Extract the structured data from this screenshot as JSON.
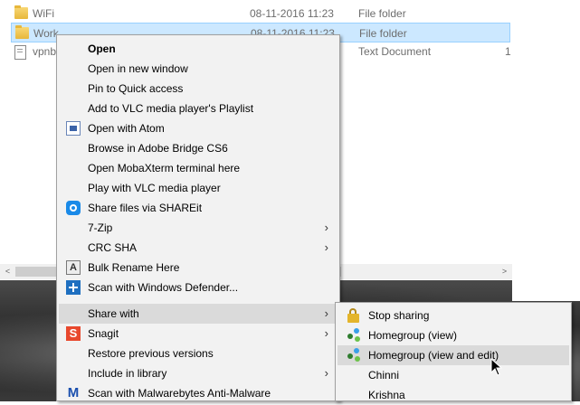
{
  "explorer": {
    "files": [
      {
        "name": "WiFi",
        "date": "08-11-2016 11:23",
        "type": "File folder",
        "size": "",
        "icon": "folder-icon",
        "selected": false
      },
      {
        "name": "Work",
        "date": "08-11-2016 11:23",
        "type": "File folder",
        "size": "",
        "icon": "folder-icon",
        "selected": true
      },
      {
        "name": "vpnb",
        "date": "",
        "type": "Text Document",
        "size": "1",
        "icon": "document-icon",
        "selected": false
      }
    ],
    "scroll_left": "<",
    "scroll_right": ">"
  },
  "context_menu": {
    "items": [
      {
        "label": "Open",
        "bold": true,
        "icon": "",
        "submenu": false
      },
      {
        "label": "Open in new window",
        "icon": "",
        "submenu": false
      },
      {
        "label": "Pin to Quick access",
        "icon": "",
        "submenu": false
      },
      {
        "label": "Add to VLC media player's Playlist",
        "icon": "",
        "submenu": false
      },
      {
        "label": "Open with Atom",
        "icon": "atom-icon",
        "submenu": false
      },
      {
        "label": "Browse in Adobe Bridge CS6",
        "icon": "",
        "submenu": false
      },
      {
        "label": "Open MobaXterm terminal here",
        "icon": "",
        "submenu": false
      },
      {
        "label": "Play with VLC media player",
        "icon": "",
        "submenu": false
      },
      {
        "label": "Share files via SHAREit",
        "icon": "shareit-icon",
        "submenu": false
      },
      {
        "label": "7-Zip",
        "icon": "",
        "submenu": true
      },
      {
        "label": "CRC SHA",
        "icon": "",
        "submenu": true
      },
      {
        "label": "Bulk Rename Here",
        "icon": "bulk-rename-icon",
        "submenu": false
      },
      {
        "label": "Scan with Windows Defender...",
        "icon": "defender-icon",
        "submenu": false
      },
      {
        "label": "Share with",
        "icon": "",
        "submenu": true,
        "hover": true
      },
      {
        "label": "Snagit",
        "icon": "snagit-icon",
        "submenu": true
      },
      {
        "label": "Restore previous versions",
        "icon": "",
        "submenu": false
      },
      {
        "label": "Include in library",
        "icon": "",
        "submenu": true
      },
      {
        "label": "Scan with Malwarebytes Anti-Malware",
        "icon": "malwarebytes-icon",
        "submenu": false
      }
    ],
    "chevron": "›"
  },
  "share_submenu": {
    "items": [
      {
        "label": "Stop sharing",
        "icon": "lock-icon"
      },
      {
        "label": "Homegroup (view)",
        "icon": "homegroup-icon"
      },
      {
        "label": "Homegroup (view and edit)",
        "icon": "homegroup-icon",
        "hover": true
      },
      {
        "label": "Chinni",
        "icon": ""
      },
      {
        "label": "Krishna",
        "icon": ""
      }
    ]
  },
  "icon_glyphs": {
    "bulk": "A",
    "snagit": "S",
    "malwarebytes": "M"
  },
  "colors": {
    "selection": "#cce8ff",
    "menu_bg": "#f2f2f2",
    "hover": "#dadada"
  }
}
